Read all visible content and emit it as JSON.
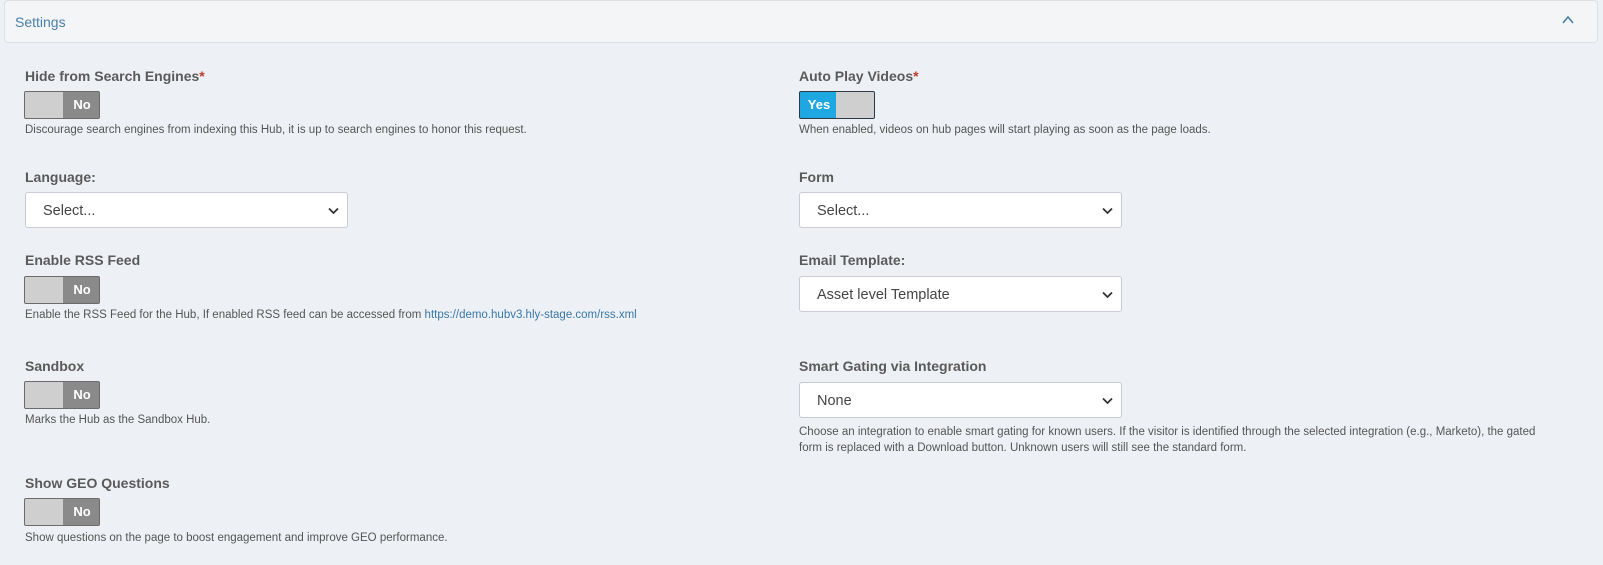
{
  "panel": {
    "title": "Settings",
    "collapse_icon": "chevron-up-icon"
  },
  "colors": {
    "accent": "#1ea7e1",
    "link": "#3a78a8",
    "required": "#c0392b"
  },
  "left": {
    "hide_search": {
      "label": "Hide from Search Engines",
      "required_mark": "*",
      "toggle": "No",
      "help": "Discourage search engines from indexing this Hub, it is up to search engines to honor this request."
    },
    "language": {
      "label": "Language:",
      "value": "Select..."
    },
    "rss": {
      "label": "Enable RSS Feed",
      "toggle": "No",
      "help": "Enable the RSS Feed for the Hub, If enabled RSS feed can be accessed from ",
      "link": "https://demo.hubv3.hly-stage.com/rss.xml"
    },
    "sandbox": {
      "label": "Sandbox",
      "toggle": "No",
      "help": "Marks the Hub as the Sandbox Hub."
    },
    "geo": {
      "label": "Show GEO Questions",
      "toggle": "No",
      "help": "Show questions on the page to boost engagement and improve GEO performance."
    }
  },
  "right": {
    "autoplay": {
      "label": "Auto Play Videos",
      "required_mark": "*",
      "toggle": "Yes",
      "help": "When enabled, videos on hub pages will start playing as soon as the page loads."
    },
    "form": {
      "label": "Form",
      "value": "Select..."
    },
    "email_template": {
      "label": "Email Template:",
      "value": "Asset level Template"
    },
    "smart_gating": {
      "label": "Smart Gating via Integration",
      "value": "None",
      "help": "Choose an integration to enable smart gating for known users. If the visitor is identified through the selected integration (e.g., Marketo), the gated form is replaced with a Download button. Unknown users will still see the standard form."
    }
  }
}
